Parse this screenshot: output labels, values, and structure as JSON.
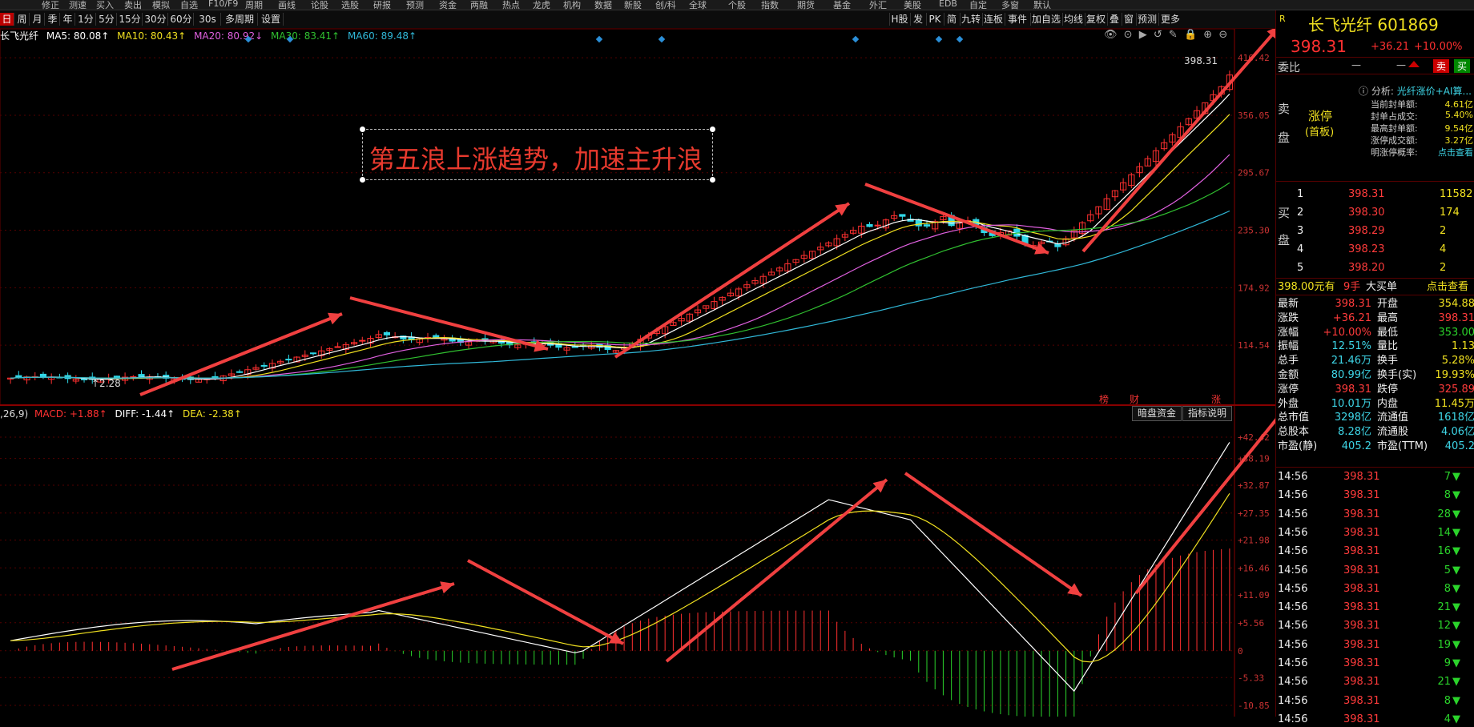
{
  "menubar": {
    "items": [
      "修正",
      "测速",
      "买入",
      "卖出",
      "模拟",
      "自选",
      "F10/F9",
      "周期",
      "画线",
      "论股",
      "选股",
      "研报",
      "预测",
      "资金",
      "两融",
      "热点",
      "龙虎",
      "机构",
      "数据",
      "新股",
      "创/科",
      "全球",
      "个股",
      "指数",
      "期货",
      "基金",
      "外汇",
      "美股",
      "EDB",
      "自定",
      "多窗",
      "默认"
    ]
  },
  "periodbar": {
    "periods": [
      "日",
      "周",
      "月",
      "季",
      "年",
      "1分",
      "5分",
      "15分",
      "30分",
      "60分",
      "30s",
      "多周期",
      "设置"
    ],
    "active_index": 0,
    "right_buttons": [
      "H股",
      "发",
      "PK",
      "简",
      "九转",
      "连板",
      "事件",
      "加自选",
      "均线",
      "复权",
      "叠",
      "窗",
      "预测",
      "更多"
    ]
  },
  "stock": {
    "name": "长飞光纤",
    "code": "601869",
    "price": "398.31",
    "change": "+36.21",
    "pct": "+10.00%",
    "badge": "R"
  },
  "ma_line": {
    "name": "长飞光纤",
    "ma5": "MA5: 80.08↑",
    "ma10": "MA10: 80.43↑",
    "ma20": "MA20: 80.92↓",
    "ma30": "MA30: 83.41↑",
    "ma60": "MA60: 89.48↑"
  },
  "price_axis": [
    "416.42",
    "356.05",
    "295.67",
    "235.30",
    "174.92",
    "114.54"
  ],
  "price_labels": {
    "high": "398.31",
    "low": "↑2.28"
  },
  "event_markers": [
    "榜",
    "财",
    "涨"
  ],
  "annotation": "第五浪上涨趋势，加速主升浪",
  "macd_line": {
    "params": ",26,9)",
    "macd": "MACD: +1.88↑",
    "diff": "DIFF: -1.44↑",
    "dea": "DEA: -2.38↑"
  },
  "macd_buttons": [
    "暗盘资金",
    "指标说明"
  ],
  "macd_axis": [
    "+42.42",
    "+38.19",
    "+32.87",
    "+27.35",
    "+21.98",
    "+16.46",
    "+11.09",
    "+5.56",
    "0",
    "-5.33",
    "-10.85"
  ],
  "panel": {
    "weibi_label": "委比",
    "weibi_dash1": "—",
    "weibi_dash2": "—",
    "buy_btn": "买",
    "sell_btn": "卖",
    "sell_side_label": "卖盘",
    "buy_side_label": "买盘",
    "limit_up": "涨停",
    "limit_up_sub": "(首板)",
    "analysis_label": "分析:",
    "analysis_text": "光纤涨价+AI算...",
    "stats": [
      {
        "k": "当前封单额:",
        "v": "4.61亿"
      },
      {
        "k": "封单占成交:",
        "v": "5.40%"
      },
      {
        "k": "最高封单额:",
        "v": "9.54亿"
      },
      {
        "k": "涨停成交额:",
        "v": "3.27亿"
      },
      {
        "k": "明涨停概率:",
        "v": "点击查看"
      }
    ],
    "bids": [
      {
        "n": "1",
        "p": "398.31",
        "v": "11582"
      },
      {
        "n": "2",
        "p": "398.30",
        "v": "174"
      },
      {
        "n": "3",
        "p": "398.29",
        "v": "2"
      },
      {
        "n": "4",
        "p": "398.23",
        "v": "4"
      },
      {
        "n": "5",
        "p": "398.20",
        "v": "2"
      }
    ],
    "big_order": {
      "price": "398.00元有",
      "qty": "9手",
      "label": "大买单",
      "link": "点击查看"
    },
    "quote": [
      {
        "k1": "最新",
        "v1": "398.31",
        "k2": "开盘",
        "v2": "354.88"
      },
      {
        "k1": "涨跌",
        "v1": "+36.21",
        "k2": "最高",
        "v2": "398.31"
      },
      {
        "k1": "涨幅",
        "v1": "+10.00%",
        "k2": "最低",
        "v2": "353.00"
      },
      {
        "k1": "振幅",
        "v1": "12.51%",
        "k2": "量比",
        "v2": "1.13"
      },
      {
        "k1": "总手",
        "v1": "21.46万",
        "k2": "换手",
        "v2": "5.28%"
      },
      {
        "k1": "金额",
        "v1": "80.99亿",
        "k2": "换手(实)",
        "v2": "19.93%"
      },
      {
        "k1": "涨停",
        "v1": "398.31",
        "k2": "跌停",
        "v2": "325.89"
      },
      {
        "k1": "外盘",
        "v1": "10.01万",
        "k2": "内盘",
        "v2": "11.45万"
      },
      {
        "k1": "总市值",
        "v1": "3298亿",
        "k2": "流通值",
        "v2": "1618亿"
      },
      {
        "k1": "总股本",
        "v1": "8.28亿",
        "k2": "流通股",
        "v2": "4.06亿"
      },
      {
        "k1": "市盈(静)",
        "v1": "405.2",
        "k2": "市盈(TTM)",
        "v2": "405.2"
      }
    ],
    "trades": [
      {
        "t": "14:56",
        "p": "398.31",
        "v": "7"
      },
      {
        "t": "14:56",
        "p": "398.31",
        "v": "8"
      },
      {
        "t": "14:56",
        "p": "398.31",
        "v": "28"
      },
      {
        "t": "14:56",
        "p": "398.31",
        "v": "14"
      },
      {
        "t": "14:56",
        "p": "398.31",
        "v": "16"
      },
      {
        "t": "14:56",
        "p": "398.31",
        "v": "5"
      },
      {
        "t": "14:56",
        "p": "398.31",
        "v": "8"
      },
      {
        "t": "14:56",
        "p": "398.31",
        "v": "21"
      },
      {
        "t": "14:56",
        "p": "398.31",
        "v": "12"
      },
      {
        "t": "14:56",
        "p": "398.31",
        "v": "19"
      },
      {
        "t": "14:56",
        "p": "398.31",
        "v": "9"
      },
      {
        "t": "14:56",
        "p": "398.31",
        "v": "21"
      },
      {
        "t": "14:56",
        "p": "398.31",
        "v": "8"
      },
      {
        "t": "14:56",
        "p": "398.31",
        "v": "4"
      }
    ]
  },
  "colors": {
    "ma5": "#ffffff",
    "ma10": "#f0e020",
    "ma20": "#e060e0",
    "ma30": "#30c030",
    "ma60": "#30b8d8",
    "up": "#ff3030",
    "down": "#30d8e8",
    "arrow": "#f04040"
  }
}
